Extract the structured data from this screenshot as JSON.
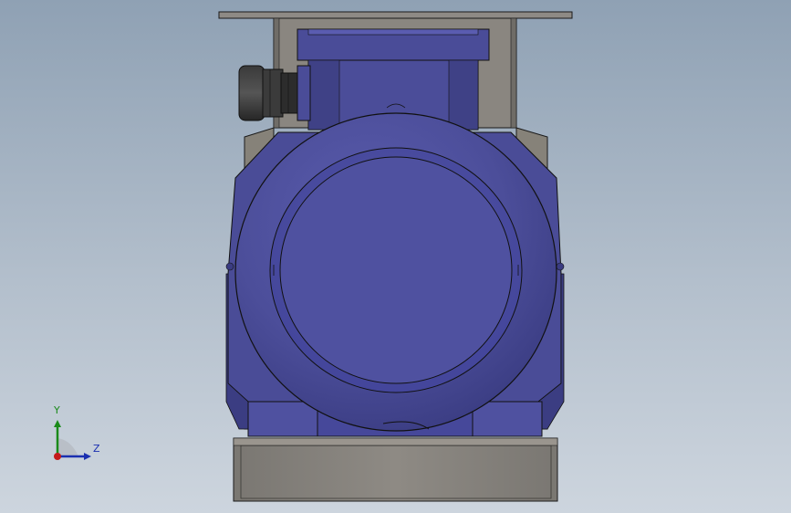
{
  "viewport": {
    "background_top": "#8fa1b4",
    "background_bottom": "#cdd5de"
  },
  "model": {
    "motor_color": "#4c4e9a",
    "frame_color": "#8a8680",
    "gland_color": "#2e2e2e"
  },
  "triad": {
    "y_label": "Y",
    "z_label": "Z",
    "y_color": "#1a8a1a",
    "z_color": "#1a2fb0",
    "x_color": "#c41a1a"
  }
}
